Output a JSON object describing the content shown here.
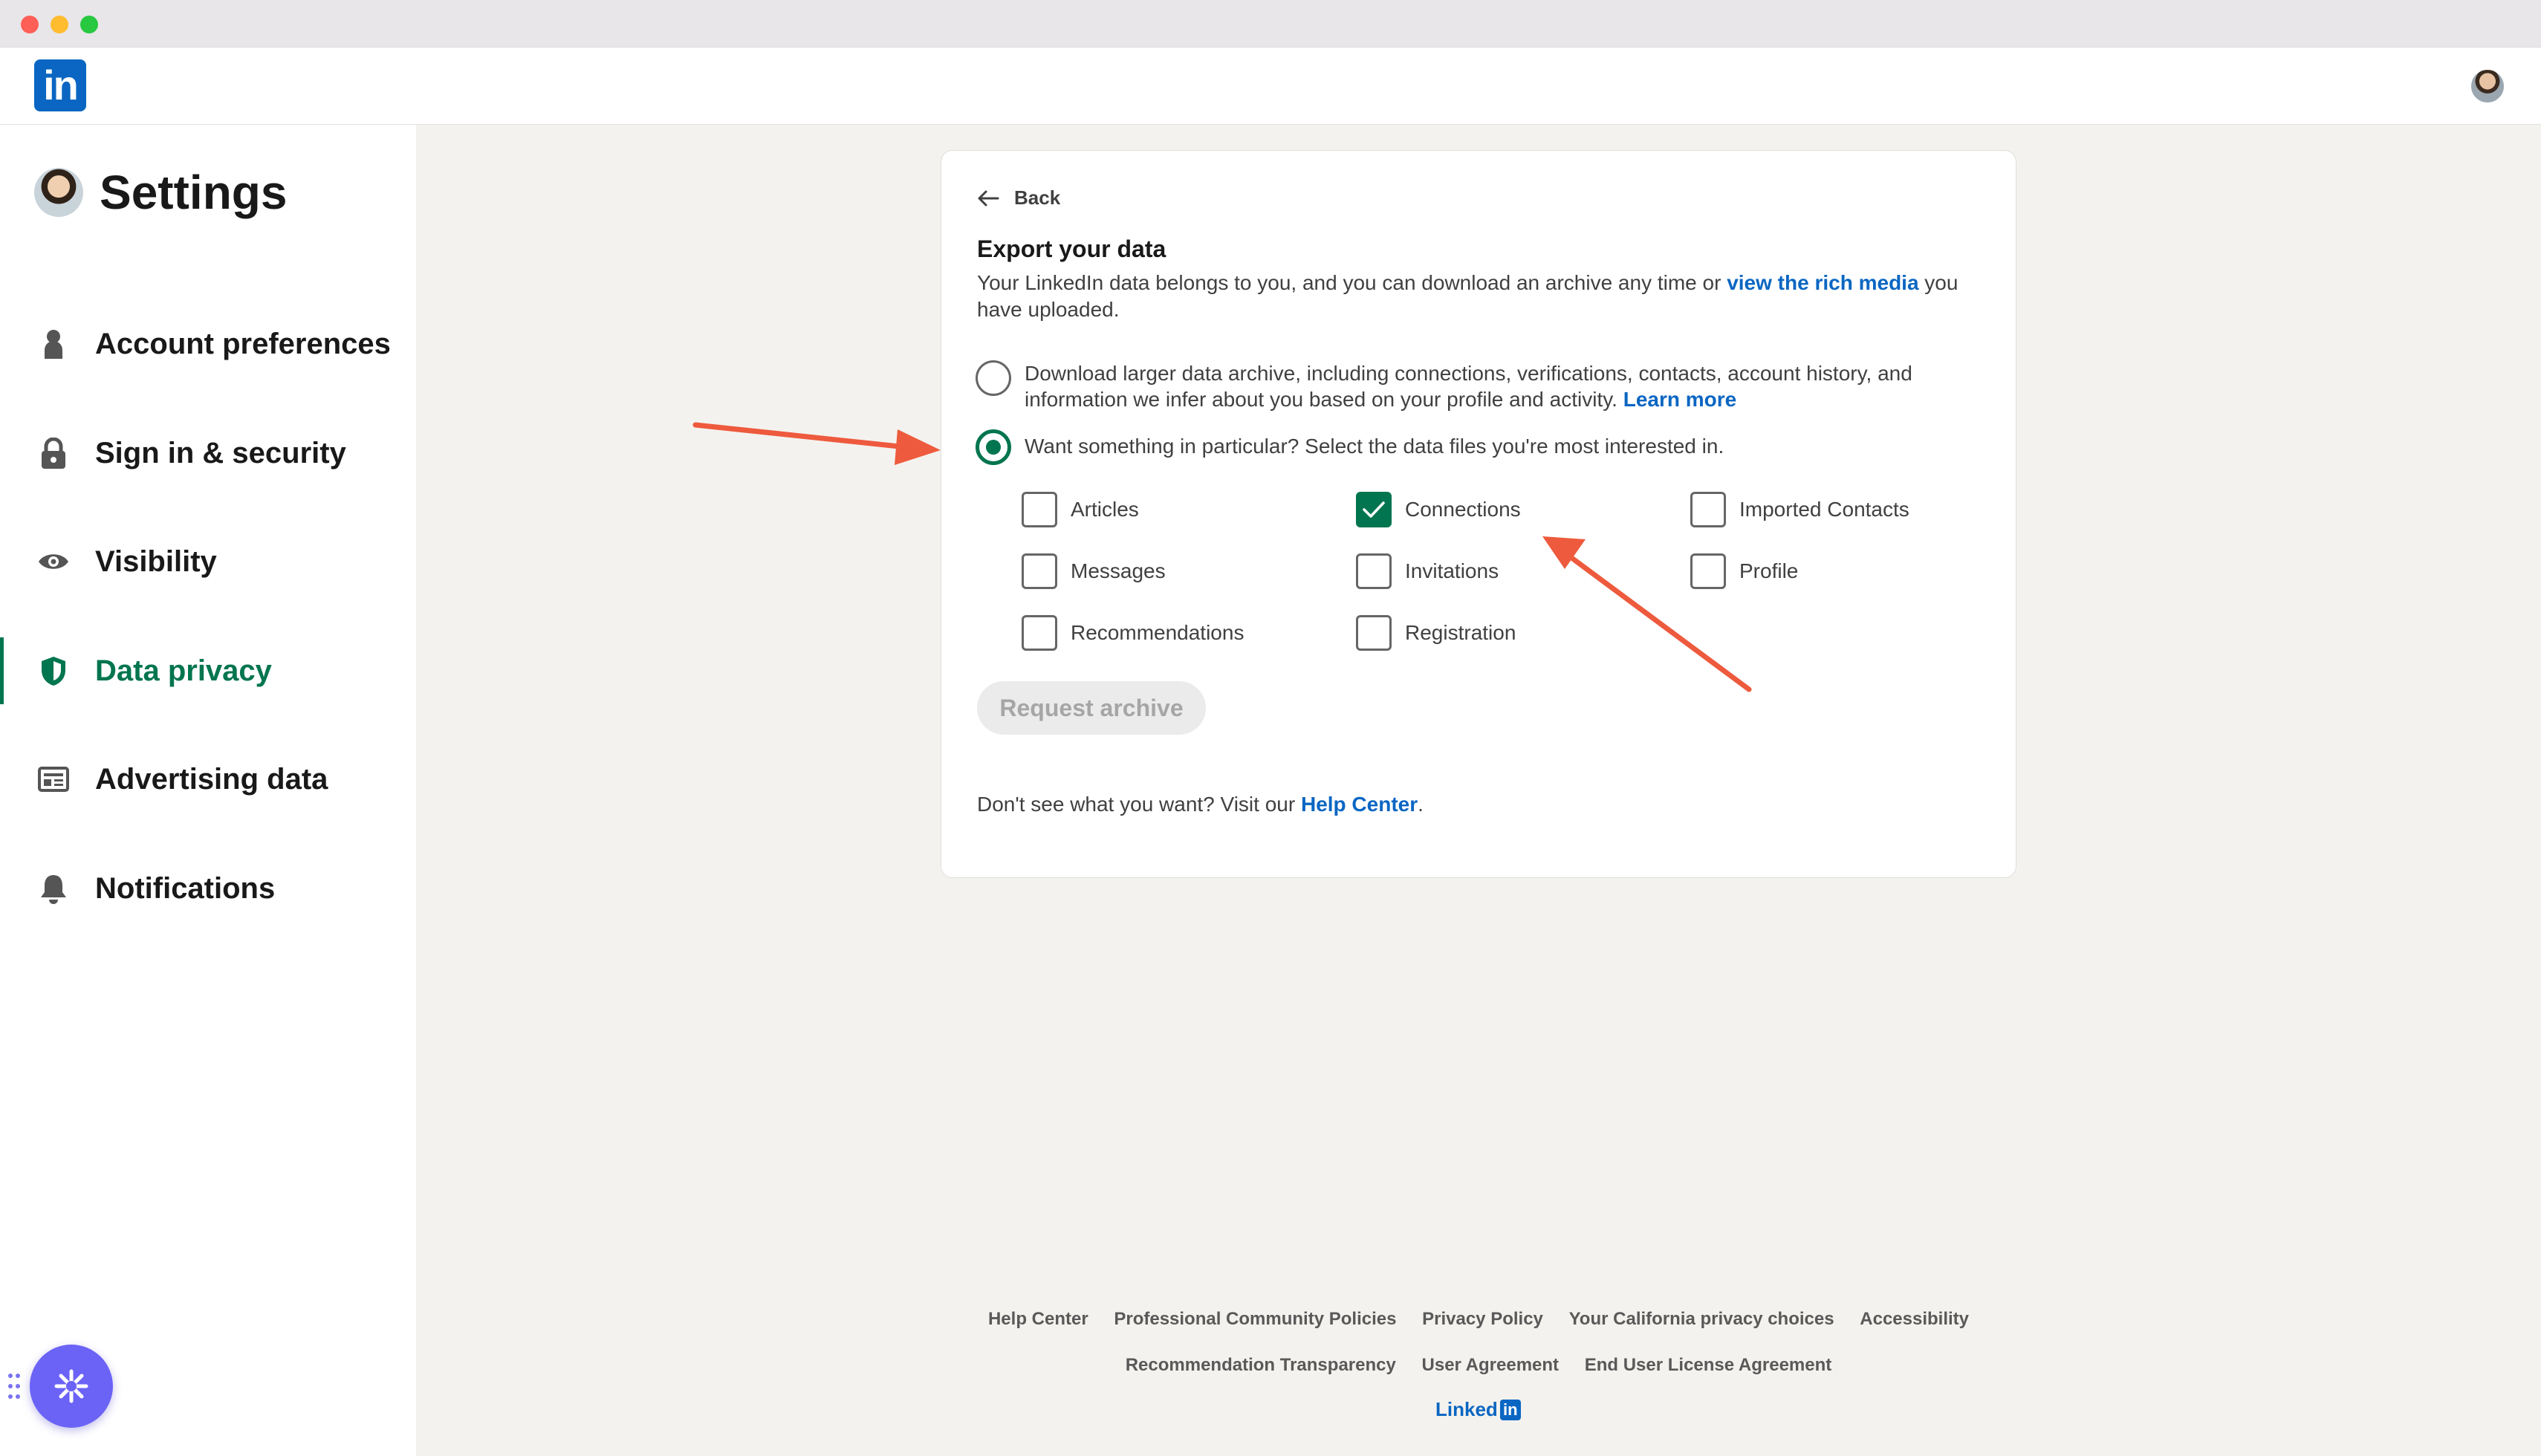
{
  "window": {
    "controls": [
      "close",
      "minimize",
      "zoom"
    ]
  },
  "nav": {
    "logo_text": "in",
    "logo_icon": "linkedin-logo",
    "avatar_icon": "profile-photo"
  },
  "sidebar": {
    "title": "Settings",
    "items": [
      {
        "label": "Account preferences",
        "icon": "person-icon",
        "active": false
      },
      {
        "label": "Sign in & security",
        "icon": "lock-icon",
        "active": false
      },
      {
        "label": "Visibility",
        "icon": "eye-icon",
        "active": false
      },
      {
        "label": "Data privacy",
        "icon": "shield-icon",
        "active": true
      },
      {
        "label": "Advertising data",
        "icon": "ad-card-icon",
        "active": false
      },
      {
        "label": "Notifications",
        "icon": "bell-icon",
        "active": false
      }
    ]
  },
  "card": {
    "back_label": "Back",
    "title": "Export your data",
    "intro_text": "Your LinkedIn data belongs to you, and you can download an archive any time or ",
    "intro_link": "view the rich media",
    "intro_tail": " you have uploaded.",
    "option_full": {
      "text": "Download larger data archive, including connections, verifications, contacts, account history, and information we infer about you based on your profile and activity. ",
      "link": "Learn more",
      "selected": false
    },
    "option_partial": {
      "text": "Want something in particular? Select the data files you're most interested in.",
      "selected": true
    },
    "checkboxes": [
      {
        "label": "Articles",
        "checked": false
      },
      {
        "label": "Messages",
        "checked": false
      },
      {
        "label": "Recommendations",
        "checked": false
      },
      {
        "label": "Connections",
        "checked": true
      },
      {
        "label": "Invitations",
        "checked": false
      },
      {
        "label": "Registration",
        "checked": false
      },
      {
        "label": "Imported Contacts",
        "checked": false
      },
      {
        "label": "Profile",
        "checked": false
      }
    ],
    "request_button": "Request archive",
    "help_prefix": "Don't see what you want? Visit our ",
    "help_link": "Help Center",
    "help_suffix": "."
  },
  "footer": {
    "row1": [
      "Help Center",
      "Professional Community Policies",
      "Privacy Policy",
      "Your California privacy choices",
      "Accessibility"
    ],
    "row2": [
      "Recommendation Transparency",
      "User Agreement",
      "End User License Agreement"
    ],
    "brand_text": "Linked",
    "brand_in": "in"
  },
  "colors": {
    "accent_green": "#01754f",
    "link_blue": "#0a66c2",
    "annotation_arrow": "#ee5a3d",
    "helper_button": "#6b63f6"
  }
}
